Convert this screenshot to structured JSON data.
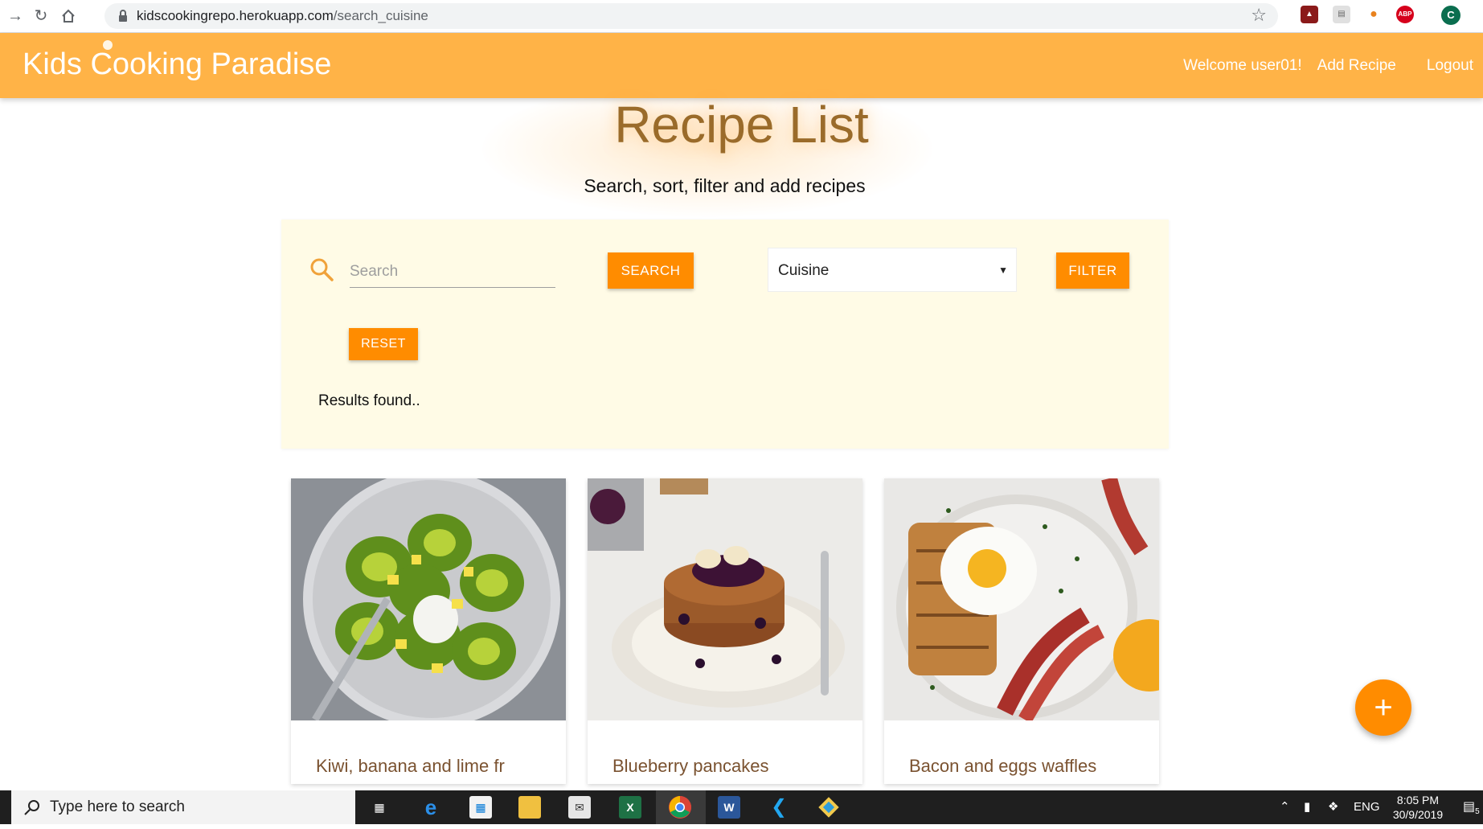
{
  "browser": {
    "url_domain": "kidscookingrepo.herokuapp.com",
    "url_path": "/search_cuisine",
    "profile_initial": "C",
    "extension_abp": "ABP"
  },
  "navbar": {
    "brand": "Kids Cooking Paradise",
    "welcome": "Welcome user01!",
    "add_recipe": "Add Recipe",
    "logout": "Logout"
  },
  "header": {
    "title": "Recipe List",
    "subtitle": "Search, sort, filter and add recipes"
  },
  "search": {
    "placeholder": "Search",
    "search_button": "SEARCH",
    "cuisine_selected": "Cuisine",
    "filter_button": "FILTER",
    "reset_button": "RESET",
    "results_text": "Results found.."
  },
  "recipes": [
    {
      "title": "Kiwi, banana and lime fr"
    },
    {
      "title": "Blueberry pancakes"
    },
    {
      "title": "Bacon and eggs waffles"
    }
  ],
  "fab": {
    "label": "+"
  },
  "taskbar": {
    "search_placeholder": "Type here to search",
    "language": "ENG",
    "time": "8:05 PM",
    "date": "30/9/2019",
    "notification_count": "5"
  },
  "colors": {
    "navbar": "#ffb347",
    "accent": "#ff8c00",
    "panel": "#fffbe6"
  }
}
